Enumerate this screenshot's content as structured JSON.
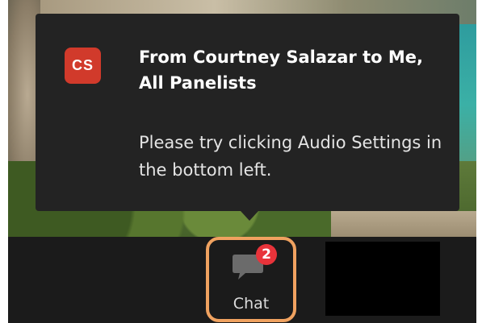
{
  "popup": {
    "avatar_initials": "CS",
    "sender_line": "From Courtney Salazar to Me, All Panelists",
    "message": "Please try clicking Audio Settings in the bottom left."
  },
  "toolbar": {
    "chat": {
      "label": "Chat",
      "badge_count": "2",
      "icon": "chat-bubble-icon",
      "highlight_color": "#f0a260"
    }
  },
  "colors": {
    "avatar_bg": "#d13a2b",
    "badge_bg": "#e8333a",
    "popup_bg": "#232323",
    "toolbar_bg": "#1b1b1b"
  }
}
